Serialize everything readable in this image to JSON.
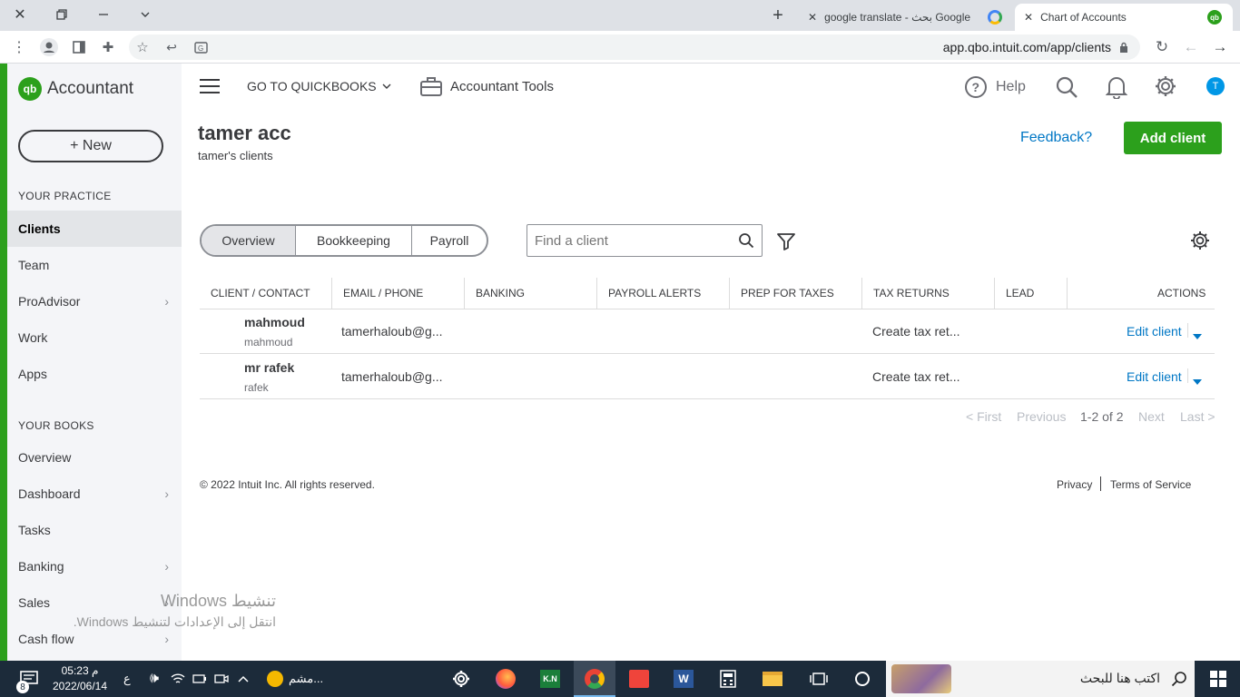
{
  "browser": {
    "tabs": [
      {
        "title": "google translate - بحث Google"
      },
      {
        "title": "Chart of Accounts"
      }
    ],
    "url": "app.qbo.intuit.com/app/clients"
  },
  "brand": {
    "name": "Accountant",
    "logo_text": "qb",
    "accent": "#2ca01c"
  },
  "sidebar": {
    "new_label": "+ New",
    "practice_heading": "YOUR PRACTICE",
    "practice_items": [
      {
        "label": "Clients"
      },
      {
        "label": "Team"
      },
      {
        "label": "ProAdvisor"
      },
      {
        "label": "Work"
      },
      {
        "label": "Apps"
      }
    ],
    "books_heading": "YOUR BOOKS",
    "books_items": [
      {
        "label": "Overview"
      },
      {
        "label": "Dashboard"
      },
      {
        "label": "Tasks"
      },
      {
        "label": "Banking"
      },
      {
        "label": "Sales"
      },
      {
        "label": "Cash flow"
      }
    ]
  },
  "topnav": {
    "goto_label": "GO TO QUICKBOOKS",
    "tools_label": "Accountant Tools",
    "help_label": "Help",
    "avatar_letter": "T"
  },
  "page": {
    "title": "tamer acc",
    "subtitle": "tamer's clients",
    "feedback_label": "Feedback?",
    "add_client_label": "Add client"
  },
  "tabs": [
    {
      "label": "Overview"
    },
    {
      "label": "Bookkeeping"
    },
    {
      "label": "Payroll"
    }
  ],
  "search": {
    "placeholder": "Find a client"
  },
  "table": {
    "headers": [
      "CLIENT / CONTACT",
      "EMAIL / PHONE",
      "BANKING",
      "PAYROLL ALERTS",
      "PREP FOR TAXES",
      "TAX RETURNS",
      "LEAD",
      "ACTIONS"
    ],
    "rows": [
      {
        "name": "mahmoud",
        "contact": "mahmoud",
        "email": "tamerhaloub@g...",
        "tax": "Create tax ret...",
        "action": "Edit client"
      },
      {
        "name": "mr rafek",
        "contact": "rafek",
        "email": "tamerhaloub@g...",
        "tax": "Create tax ret...",
        "action": "Edit client"
      }
    ]
  },
  "pagination": {
    "first": "< First",
    "previous": "Previous",
    "range": "1-2 of 2",
    "next": "Next",
    "last": "Last >"
  },
  "footer": {
    "copyright": "© 2022 Intuit Inc. All rights reserved.",
    "privacy": "Privacy",
    "terms": "Terms of Service"
  },
  "watermark": {
    "line1": "تنشيط Windows",
    "line2": "انتقل إلى الإعدادات لتنشيط Windows."
  },
  "taskbar": {
    "time": "05:23 م",
    "date": "2022/06/14",
    "notif_count": "8",
    "lang": "ع",
    "pinned_label": "مشم...",
    "search_placeholder": "اكتب هنا للبحث"
  }
}
